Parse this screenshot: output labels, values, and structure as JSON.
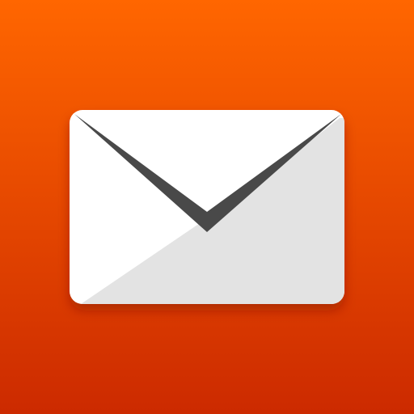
{
  "icon": {
    "name": "envelope-icon",
    "colors": {
      "background_top": "#FF6600",
      "background_bottom": "#CC2A00",
      "envelope_front": "#FFFFFF",
      "envelope_back": "#E3E3E3",
      "flap_stroke": "#4A4A4A",
      "shadow": "#7A1A00"
    }
  }
}
